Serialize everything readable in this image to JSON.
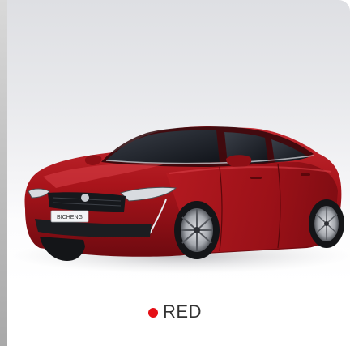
{
  "car_image": {
    "icon": "car-photo",
    "plate_text": "BICHENG"
  },
  "color_option": {
    "label": "RED",
    "swatch_color": "#e50f16"
  },
  "colors": {
    "body": "#a9141b",
    "body_dark": "#6e0a10",
    "body_highlight": "#d94047",
    "background_top": "#dedfe3"
  }
}
